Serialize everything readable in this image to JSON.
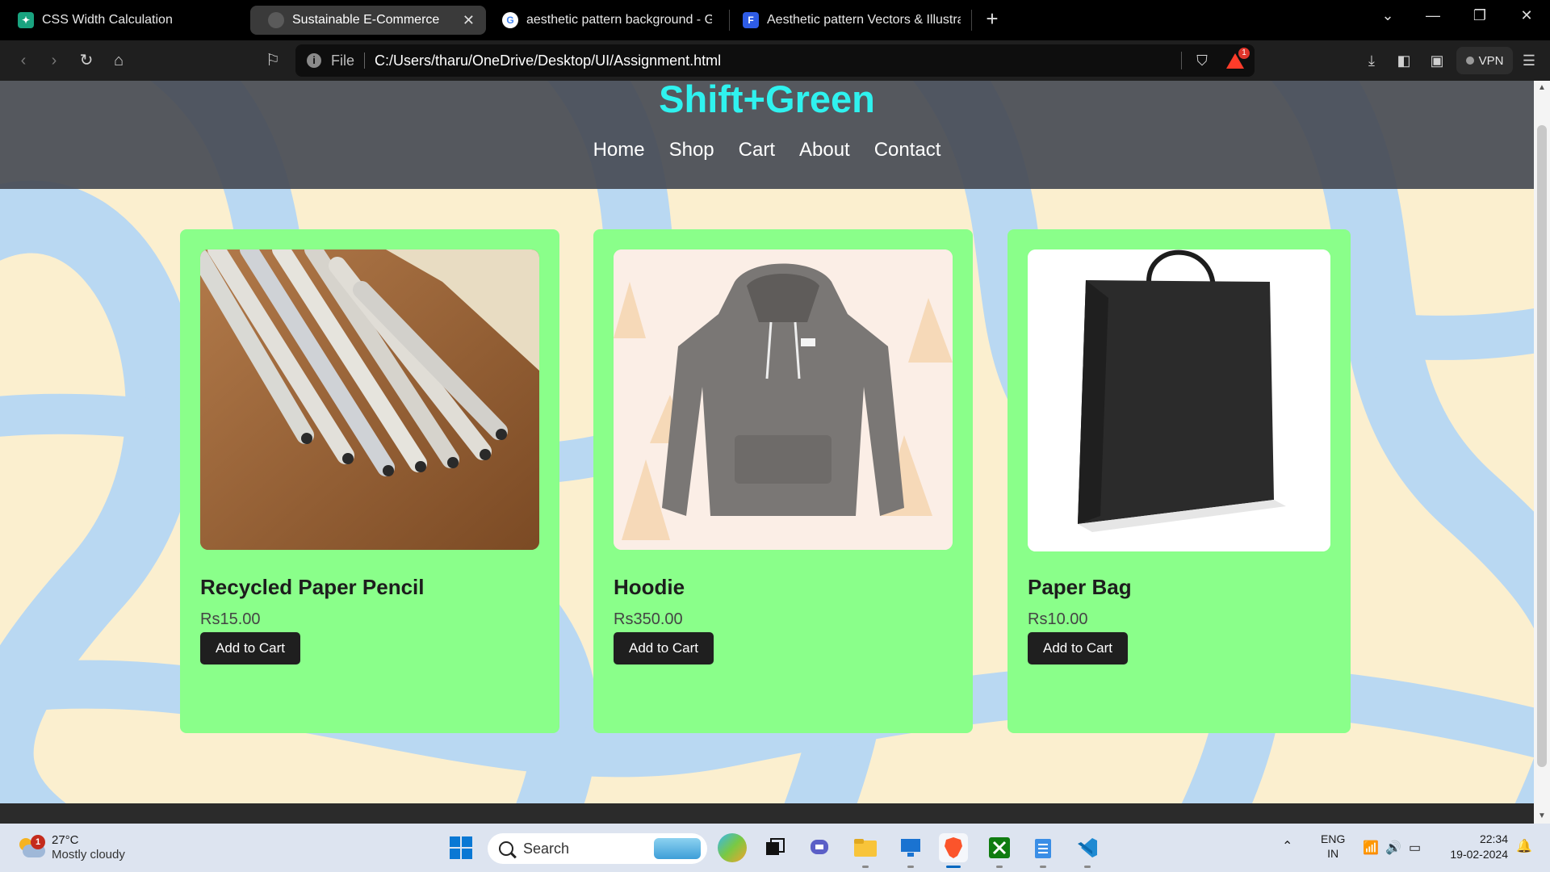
{
  "browser": {
    "tabs": [
      {
        "label": "CSS Width Calculation",
        "icon": "chatgpt-icon",
        "active": false
      },
      {
        "label": "Sustainable E-Commerce",
        "icon": "globe-icon",
        "active": true
      },
      {
        "label": "aesthetic pattern background - Goog",
        "icon": "google-icon",
        "active": false
      },
      {
        "label": "Aesthetic pattern Vectors & Illustratio",
        "icon": "freepik-icon",
        "active": false
      }
    ],
    "address": {
      "scheme_label": "File",
      "url": "C:/Users/tharu/OneDrive/Desktop/UI/Assignment.html"
    },
    "rewards_badge": "1",
    "vpn_label": "VPN"
  },
  "site": {
    "brand": "Shift+Green",
    "brand_color": "#2ff2ef",
    "nav": [
      "Home",
      "Shop",
      "Cart",
      "About",
      "Contact"
    ],
    "card_color": "#8aff8a",
    "products": [
      {
        "name": "Recycled Paper Pencil",
        "price": "Rs15.00",
        "button": "Add to Cart",
        "image": "recycled-pencils-photo"
      },
      {
        "name": "Hoodie",
        "price": "Rs350.00",
        "button": "Add to Cart",
        "image": "grey-hoodie-photo"
      },
      {
        "name": "Paper Bag",
        "price": "Rs10.00",
        "button": "Add to Cart",
        "image": "black-paper-bag-photo"
      }
    ]
  },
  "taskbar": {
    "weather": {
      "temp": "27°C",
      "condition": "Mostly cloudy",
      "badge": "1"
    },
    "search_placeholder": "Search",
    "language": {
      "line1": "ENG",
      "line2": "IN"
    },
    "clock": {
      "time": "22:34",
      "date": "19-02-2024"
    }
  }
}
